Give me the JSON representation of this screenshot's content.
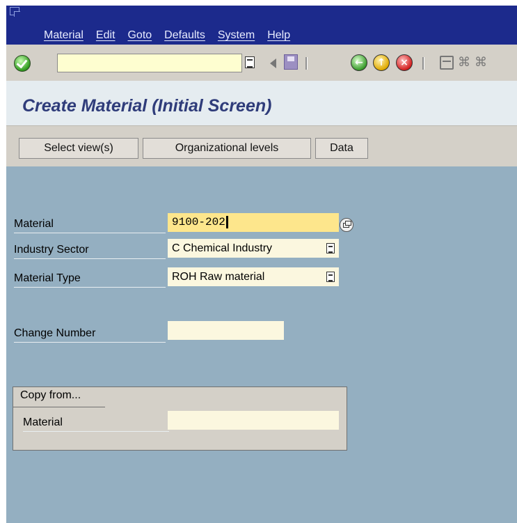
{
  "menubar": {
    "items": [
      "Material",
      "Edit",
      "Goto",
      "Defaults",
      "System",
      "Help"
    ]
  },
  "toolbar": {
    "command_field_value": "",
    "icons": [
      "enter-check-icon",
      "command-dropdown-icon",
      "back-arrow-icon",
      "save-icon",
      "back-icon",
      "exit-icon",
      "cancel-icon",
      "print-icon",
      "find-icon",
      "find-next-icon"
    ]
  },
  "page": {
    "title": "Create Material (Initial Screen)"
  },
  "appbar": {
    "select_views_label": "Select view(s)",
    "org_levels_label": "Organizational levels",
    "data_label": "Data"
  },
  "form": {
    "material_label": "Material",
    "material_value": "9100-202",
    "industry_sector_label": "Industry Sector",
    "industry_sector_value": "C Chemical Industry",
    "material_type_label": "Material Type",
    "material_type_value": "ROH Raw material",
    "change_number_label": "Change Number",
    "change_number_value": ""
  },
  "copy_from": {
    "tab_label": "Copy from...",
    "material_label": "Material",
    "material_value": ""
  },
  "colors": {
    "menubar": "#1c2a8c",
    "background": "#94afc1",
    "title": "#2f3c7a",
    "required_field": "#fde68c",
    "input_field": "#fbf7df"
  }
}
